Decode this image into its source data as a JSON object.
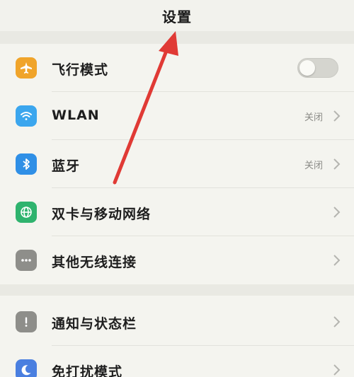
{
  "header": {
    "title": "设置"
  },
  "colors": {
    "airplane_icon": "#f0a42a",
    "wlan_icon": "#3ba6ee",
    "bluetooth_icon": "#2f8fe6",
    "dual_sim_icon": "#2fb36e",
    "wireless_icon": "#8e8e8a",
    "notification_icon": "#8e8e8a",
    "dnd_icon": "#4a7fe0",
    "annotation_arrow": "#e03a35"
  },
  "settings": {
    "airplane": {
      "label": "飞行模式",
      "icon": "airplane-icon",
      "toggle_on": false
    },
    "wlan": {
      "label": "WLAN",
      "value": "关闭",
      "icon": "wifi-icon"
    },
    "bluetooth": {
      "label": "蓝牙",
      "value": "关闭",
      "icon": "bluetooth-icon"
    },
    "dual_sim": {
      "label": "双卡与移动网络",
      "icon": "globe-icon"
    },
    "other_wireless": {
      "label": "其他无线连接",
      "icon": "more-dots-icon"
    },
    "notifications": {
      "label": "通知与状态栏",
      "icon": "exclamation-icon"
    },
    "dnd": {
      "label": "免打扰模式",
      "icon": "moon-icon"
    }
  }
}
